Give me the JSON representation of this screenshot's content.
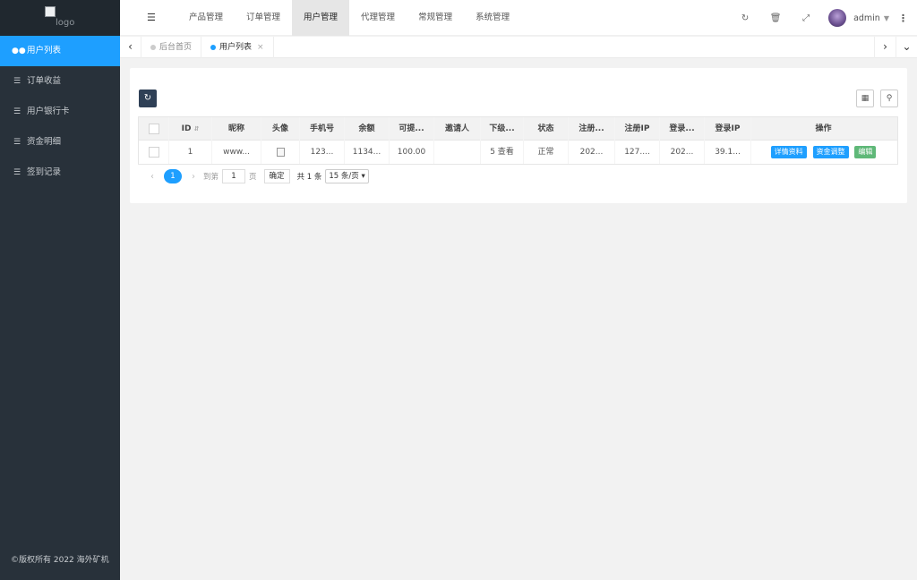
{
  "sidebar": {
    "logo_alt": "logo",
    "items": [
      {
        "label": "用户列表",
        "icon": "users-icon"
      },
      {
        "label": "订单收益",
        "icon": "list-icon"
      },
      {
        "label": "用户银行卡",
        "icon": "list-icon"
      },
      {
        "label": "资金明细",
        "icon": "list-icon"
      },
      {
        "label": "签到记录",
        "icon": "list-icon"
      }
    ],
    "copyright": "©版权所有 2022 海外矿机"
  },
  "header": {
    "nav": [
      "产品管理",
      "订单管理",
      "用户管理",
      "代理管理",
      "常规管理",
      "系统管理"
    ],
    "active_nav": "用户管理",
    "user": "admin"
  },
  "tabs": [
    {
      "label": "后台首页"
    },
    {
      "label": "用户列表"
    }
  ],
  "table": {
    "columns": [
      "ID",
      "昵称",
      "头像",
      "手机号",
      "余额",
      "可提...",
      "邀请人",
      "下级...",
      "状态",
      "注册...",
      "注册IP",
      "登录...",
      "登录IP",
      "操作"
    ],
    "rows": [
      {
        "id": "1",
        "nickname": "www...",
        "phone": "123...",
        "balance": "1134...",
        "withdrawable": "100.00",
        "inviter": "",
        "subordinates": "5 查看",
        "status": "正常",
        "reg_time": "202...",
        "reg_ip": "127....",
        "login_time": "202...",
        "login_ip": "39.1...",
        "actions": [
          "详情资料",
          "资金调整",
          "编辑"
        ]
      }
    ]
  },
  "pager": {
    "current": "1",
    "goto_label": "到第",
    "goto_value": "1",
    "page_unit": "页",
    "confirm": "确定",
    "total": "共 1 条",
    "per_page": "15 条/页"
  }
}
